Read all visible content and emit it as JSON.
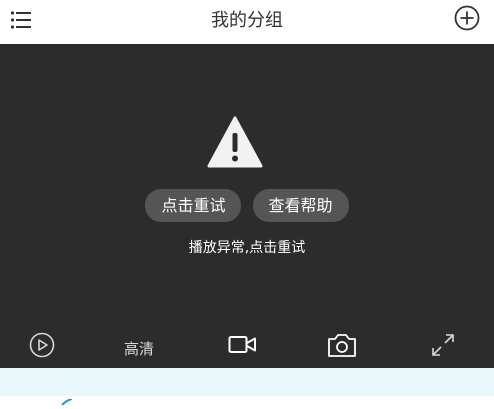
{
  "header": {
    "title": "我的分组",
    "menu_icon": "menu-icon",
    "add_icon": "add-circle-icon"
  },
  "player": {
    "error_icon": "warning-icon",
    "retry_label": "点击重试",
    "help_label": "查看帮助",
    "error_message": "播放异常,点击重试"
  },
  "controls": {
    "play_icon": "play-icon",
    "quality_label": "高清",
    "record_icon": "video-record-icon",
    "snapshot_icon": "camera-icon",
    "fullscreen_icon": "fullscreen-icon"
  },
  "colors": {
    "header_bg": "#ffffff",
    "video_bg": "#2c2c2c",
    "pill_bg": "#555555",
    "warning_fill": "#f2f2f2",
    "bottom_bg": "#e9f8fc",
    "accent": "#1e9ad6"
  }
}
